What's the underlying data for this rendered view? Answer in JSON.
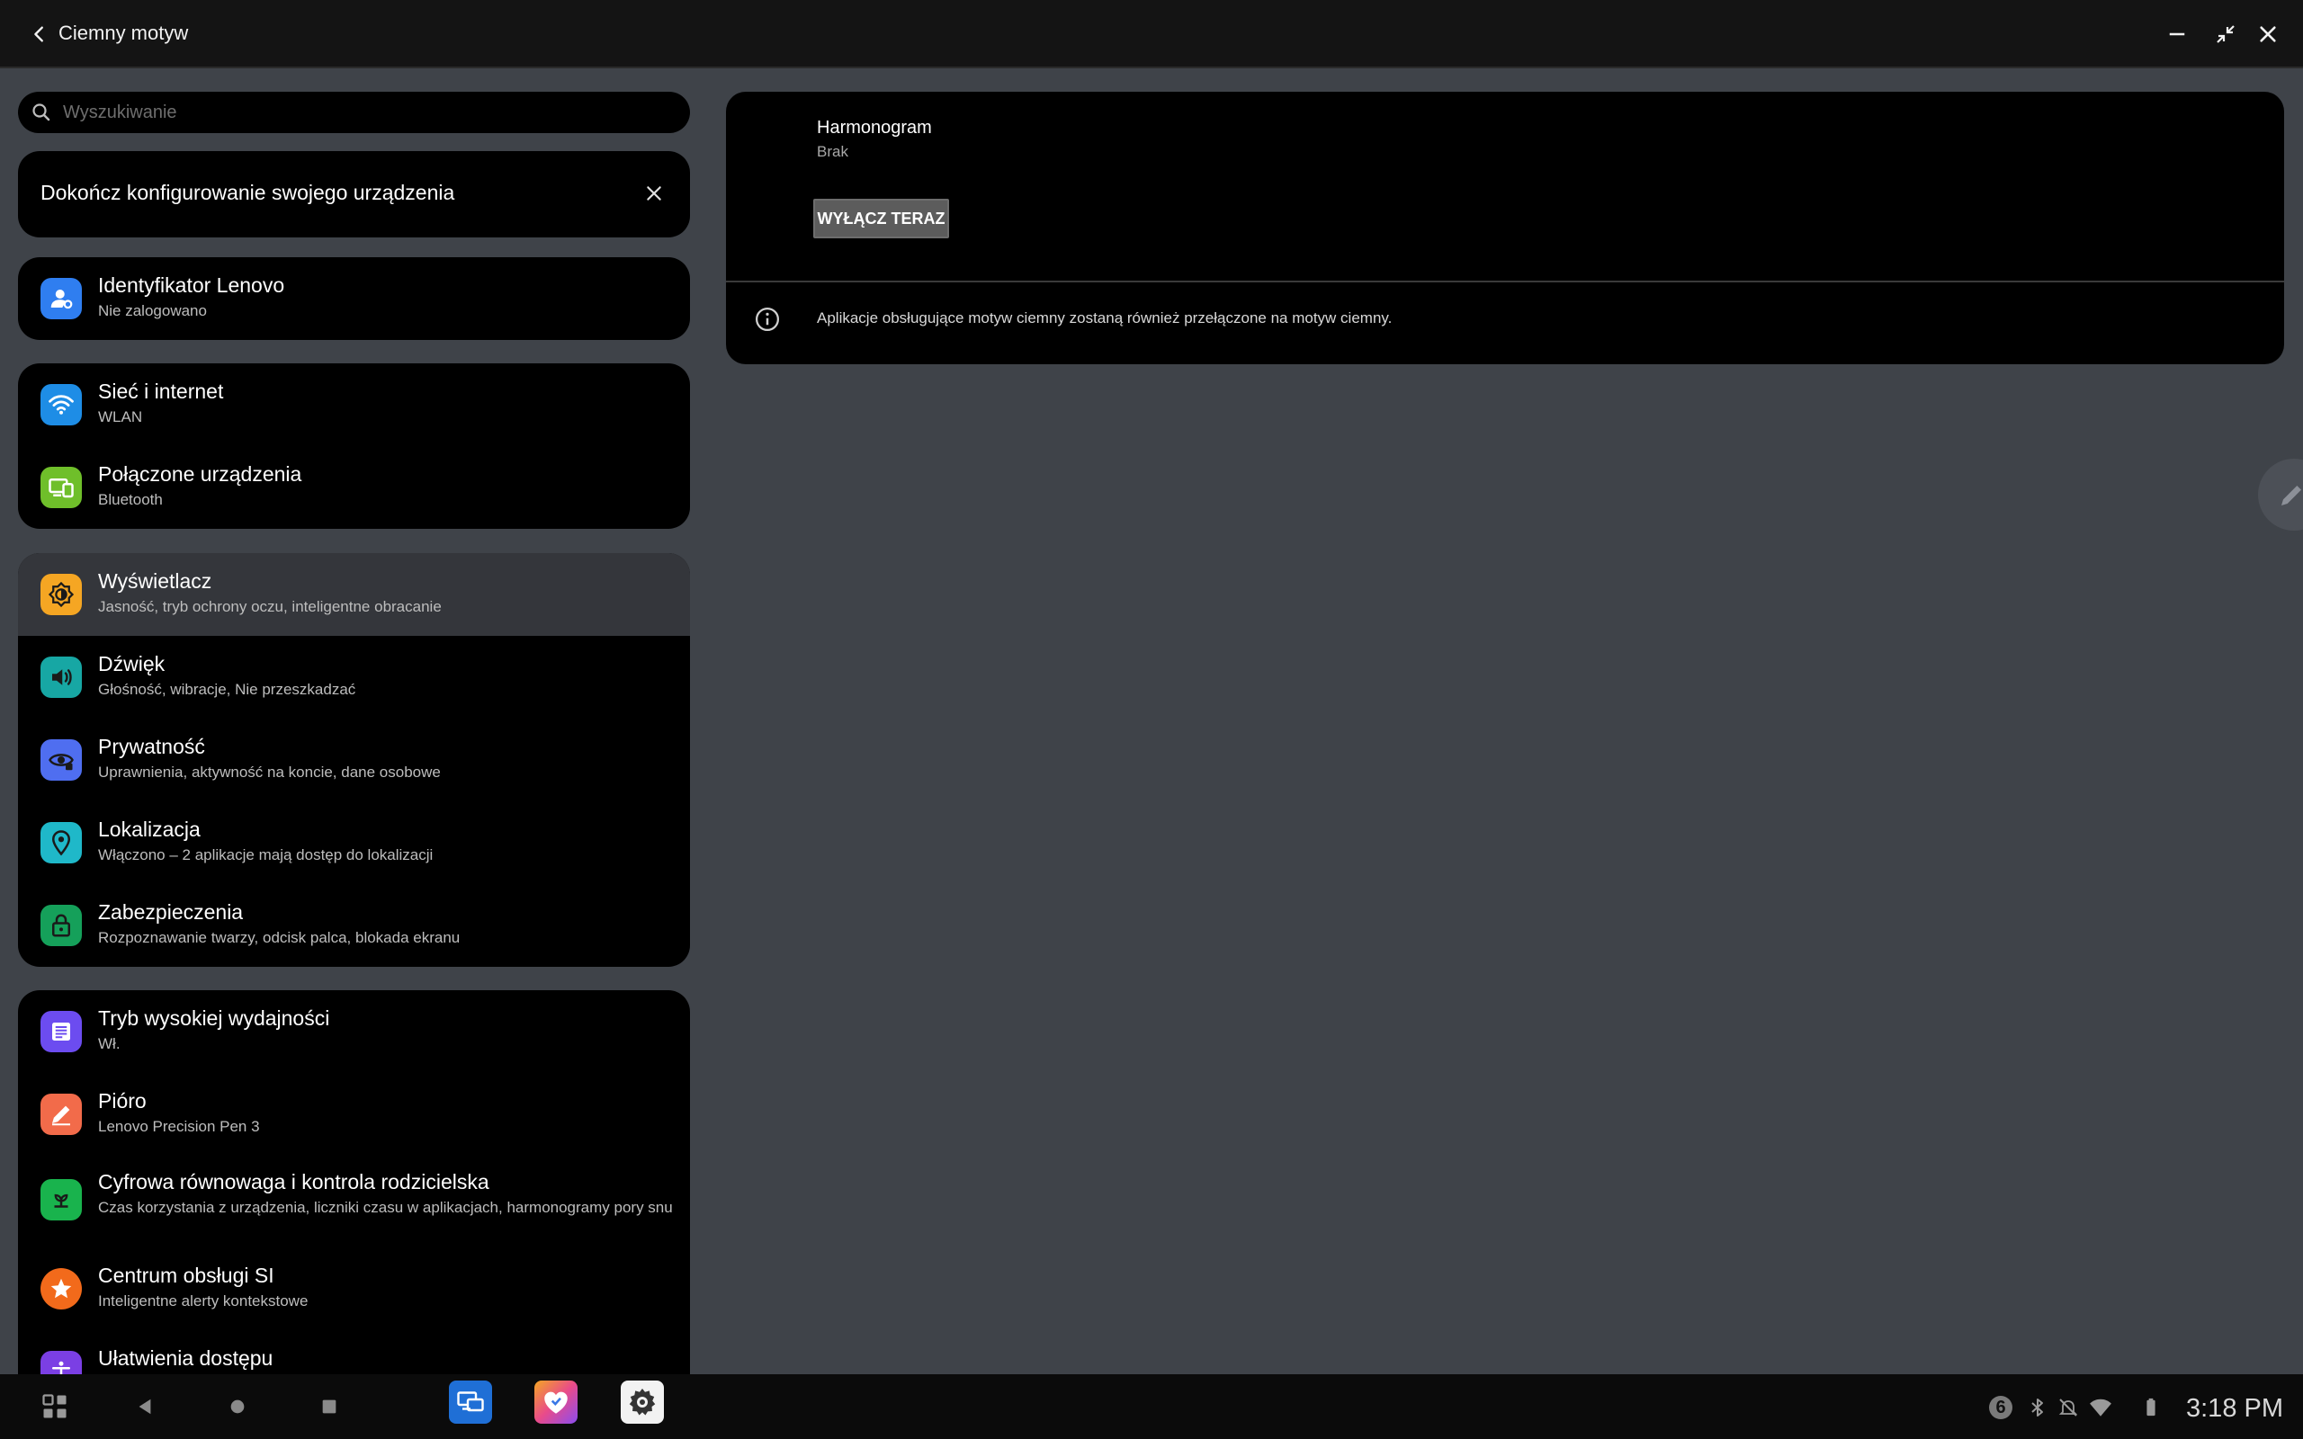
{
  "titlebar": {
    "title": "Ciemny motyw"
  },
  "search": {
    "placeholder": "Wyszukiwanie"
  },
  "setup_card": {
    "text": "Dokończ konfigurowanie swojego urządzenia"
  },
  "account": {
    "title": "Identyfikator Lenovo",
    "subtitle": "Nie zalogowano",
    "color": "#2f7ef0"
  },
  "connectivity": [
    {
      "title": "Sieć i internet",
      "subtitle": "WLAN",
      "color": "#1e8de6"
    },
    {
      "title": "Połączone urządzenia",
      "subtitle": "Bluetooth",
      "color": "#6fbf2a"
    }
  ],
  "system": [
    {
      "title": "Wyświetlacz",
      "subtitle": "Jasność, tryb ochrony oczu, inteligentne obracanie",
      "color": "#f5a623"
    },
    {
      "title": "Dźwięk",
      "subtitle": "Głośność, wibracje, Nie przeszkadzać",
      "color": "#17a7a4"
    },
    {
      "title": "Prywatność",
      "subtitle": "Uprawnienia, aktywność na koncie, dane osobowe",
      "color": "#4f6ef0"
    },
    {
      "title": "Lokalizacja",
      "subtitle": "Włączono – 2 aplikacje mają dostęp do lokalizacji",
      "color": "#1fb8c9"
    },
    {
      "title": "Zabezpieczenia",
      "subtitle": "Rozpoznawanie twarzy, odcisk palca, blokada ekranu",
      "color": "#15a05a"
    }
  ],
  "features": [
    {
      "title": "Tryb wysokiej wydajności",
      "subtitle": "Wł.",
      "color": "#6c4cf0"
    },
    {
      "title": "Pióro",
      "subtitle": "Lenovo Precision Pen 3",
      "color": "#f26b4a"
    },
    {
      "title": "Cyfrowa równowaga i kontrola rodzicielska",
      "subtitle": "Czas korzystania z urządzenia, liczniki czasu w aplikacjach, harmonogramy pory snu",
      "color": "#19b34d"
    },
    {
      "title": "Centrum obsługi SI",
      "subtitle": "Inteligentne alerty kontekstowe",
      "color": "#f26a1b"
    },
    {
      "title": "Ułatwienia dostępu",
      "subtitle": "",
      "color": "#7b3fe4"
    }
  ],
  "dark_theme": {
    "schedule_title": "Harmonogram",
    "schedule_value": "Brak",
    "turn_off_button": "WYŁĄCZ TERAZ",
    "info": "Aplikacje obsługujące motyw ciemny zostaną również przełączone na motyw ciemny."
  },
  "status": {
    "notification_count": "6",
    "time": "3:18 PM"
  }
}
